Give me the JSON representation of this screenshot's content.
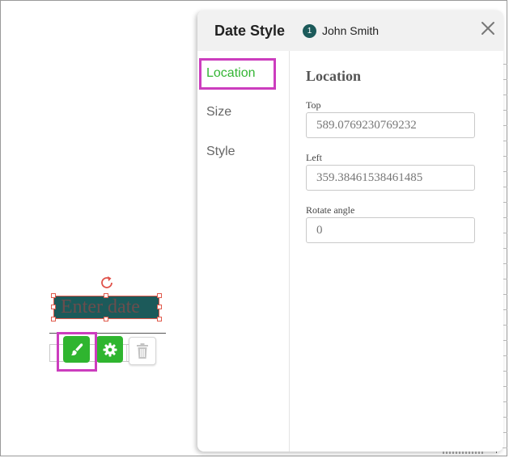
{
  "canvas": {
    "date_field": {
      "placeholder": "Enter date"
    }
  },
  "dialog": {
    "title": "Date Style",
    "signer": {
      "badge": "1",
      "name": "John Smith"
    },
    "nav": [
      {
        "label": "Location",
        "active": true
      },
      {
        "label": "Size",
        "active": false
      },
      {
        "label": "Style",
        "active": false
      }
    ],
    "location": {
      "section_title": "Location",
      "top": {
        "label": "Top",
        "value": "589.0769230769232"
      },
      "left": {
        "label": "Left",
        "value": "359.38461538461485"
      },
      "rotate": {
        "label": "Rotate angle",
        "value": "0"
      }
    }
  },
  "colors": {
    "accent_green": "#2fb52f",
    "field_fill": "#1c5a5a",
    "highlight": "#cc3dbe",
    "handle_border": "#e05a4c"
  },
  "icons": {
    "rotate": "rotate-icon",
    "brush": "paintbrush-icon",
    "settings": "gear-icon",
    "delete": "trash-icon",
    "close": "close-icon"
  }
}
